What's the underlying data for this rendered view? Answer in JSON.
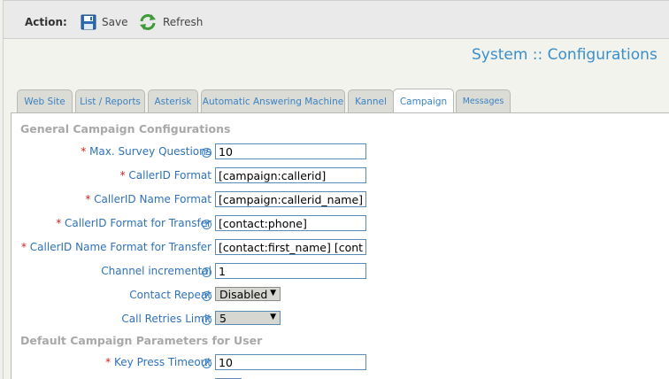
{
  "toolbar": {
    "action_label": "Action:",
    "save_label": "Save",
    "refresh_label": "Refresh"
  },
  "page": {
    "title": "System :: Configurations"
  },
  "tabs": [
    {
      "label": "Web Site"
    },
    {
      "label": "List / Reports"
    },
    {
      "label": "Asterisk"
    },
    {
      "label": "Automatic Answering Machine"
    },
    {
      "label": "Kannel"
    },
    {
      "label": "Campaign",
      "active": true
    },
    {
      "label": "Messages"
    }
  ],
  "sections": {
    "general": "General Campaign Configurations",
    "defaults": "Default Campaign Parameters for User"
  },
  "fields": {
    "max_survey_questions": {
      "label": "Max. Survey Questions",
      "value": "10"
    },
    "callerid_format": {
      "label": "CallerID Format",
      "value": "[campaign:callerid]"
    },
    "callerid_name_format": {
      "label": "CallerID Name Format",
      "value": "[campaign:callerid_name]"
    },
    "callerid_format_transfer": {
      "label": "CallerID Format for Transfer",
      "value": "[contact:phone]"
    },
    "callerid_name_format_transfer": {
      "label": "CallerID Name Format for Transfer",
      "value": "[contact:first_name] [contact:"
    },
    "channel_incremental": {
      "label": "Channel incremental",
      "value": "1"
    },
    "contact_repeat": {
      "label": "Contact Repeat",
      "value": "Disabled"
    },
    "call_retries_limit": {
      "label": "Call Retries Limit",
      "value": "5"
    },
    "key_press_timeout": {
      "label": "Key Press Timeout",
      "value": "10"
    }
  },
  "required_marker": "*",
  "help_glyph": "?",
  "colors": {
    "accent": "#3b82c4",
    "title": "#3b8fc9",
    "required": "#cc2222",
    "section": "#a8a8a8"
  }
}
